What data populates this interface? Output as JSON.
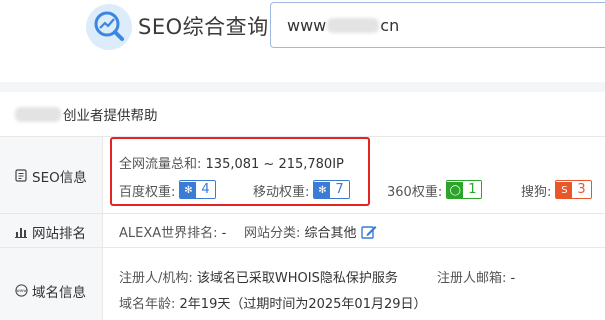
{
  "header": {
    "app_title": "SEO综合查询",
    "search_prefix": "www",
    "search_suffix": "cn"
  },
  "site": {
    "title_suffix": "创业者提供帮助"
  },
  "seo": {
    "label": "SEO信息",
    "total_traffic_label": "全网流量总和:",
    "total_traffic_value": "135,081 ~ 215,780IP",
    "baidu_label": "百度权重:",
    "baidu_value": "4",
    "mobile_label": "移动权重:",
    "mobile_value": "7",
    "so360_label": "360权重:",
    "so360_value": "1",
    "sogou_label": "搜狗:",
    "sogou_value": "3"
  },
  "ranking": {
    "label": "网站排名",
    "alexa_label": "ALEXA世界排名:",
    "alexa_value": "-",
    "category_label": "网站分类:",
    "category_value": "综合其他"
  },
  "domain": {
    "label": "域名信息",
    "registrant_label": "注册人/机构:",
    "registrant_value": "该域名已采取WHOIS隐私保护服务",
    "email_label": "注册人邮箱:",
    "email_value": "-",
    "age_label": "域名年龄:",
    "age_value": "2年19天（过期时间为2025年01月29日）"
  },
  "icons": {
    "logo": "trend-magnifier-icon",
    "seo": "document-icon",
    "ranking": "bar-chart-icon",
    "domain": "www-globe-icon",
    "edit": "edit-icon"
  },
  "colors": {
    "accent_blue": "#3a7bd5",
    "highlight_red": "#e42323",
    "green": "#2aa52a",
    "orange": "#e8562a"
  }
}
